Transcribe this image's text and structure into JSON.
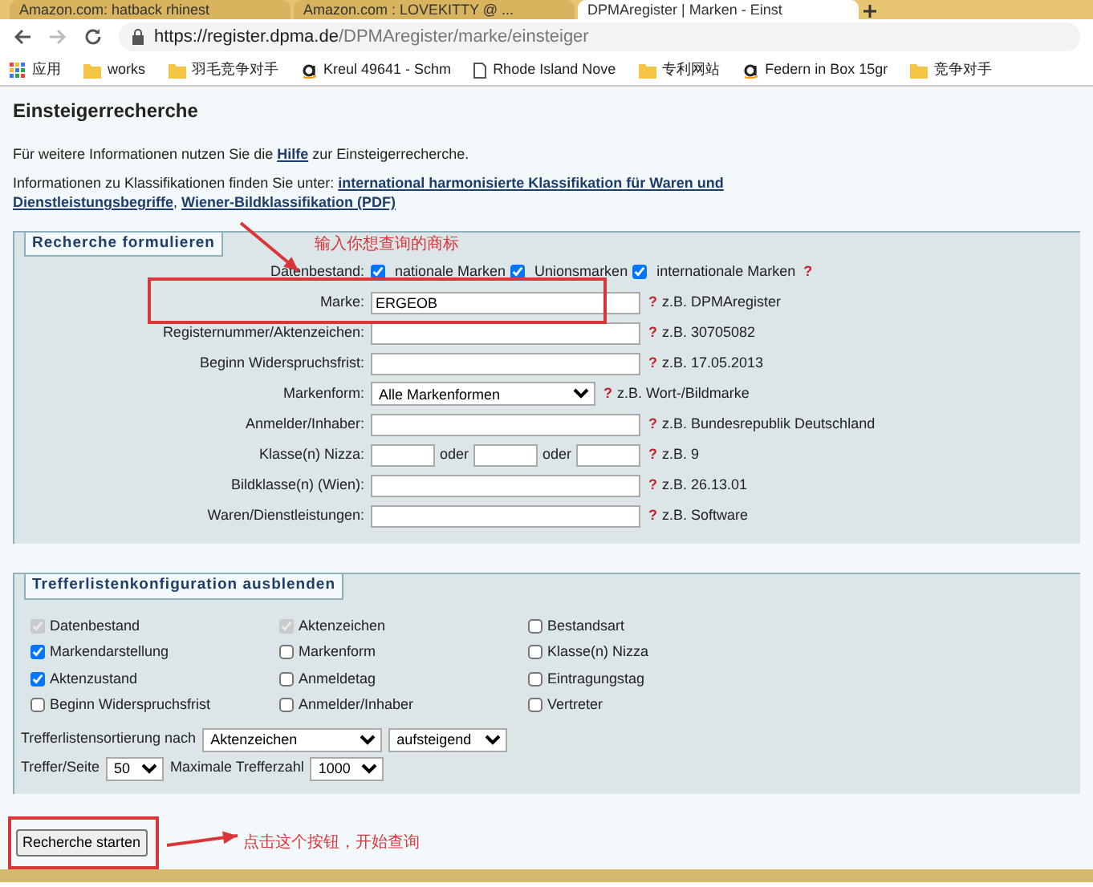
{
  "browser": {
    "tabs": [
      {
        "title": "Amazon.com: hatback rhinest",
        "selected": false
      },
      {
        "title": "Amazon.com : LOVEKITTY @ ...",
        "selected": false
      },
      {
        "title": "DPMAregister | Marken - Einst",
        "selected": true
      }
    ],
    "url_host": "https://register.dpma.de",
    "url_path": "/DPMAregister/marke/einsteiger",
    "bookmarks": [
      {
        "label": "应用",
        "kind": "apps"
      },
      {
        "label": "works",
        "kind": "folder"
      },
      {
        "label": "羽毛竞争对手",
        "kind": "folder"
      },
      {
        "label": "Kreul 49641 - Schm",
        "kind": "amazon"
      },
      {
        "label": "Rhode Island Nove",
        "kind": "page"
      },
      {
        "label": "专利网站",
        "kind": "folder"
      },
      {
        "label": "Federn in Box 15gr",
        "kind": "amazon"
      },
      {
        "label": "竞争对手",
        "kind": "folder"
      }
    ]
  },
  "page": {
    "title": "Einsteigerrecherche",
    "paragraphs": [
      [
        {
          "text": "Für weitere Informationen nutzen Sie die ",
          "kind": "text"
        },
        {
          "text": "Hilfe",
          "kind": "link"
        },
        {
          "text": " zur Einsteigerrecherche.",
          "kind": "text"
        }
      ],
      [
        {
          "text": "Informationen zu Klassifikationen finden Sie unter: ",
          "kind": "text"
        },
        {
          "text": "international harmonisierte Klassifikation für Waren und",
          "kind": "link"
        },
        {
          "text": "Dienstleistungsbegriffe",
          "kind": "link"
        },
        {
          "text": ", ",
          "kind": "text"
        },
        {
          "text": "Wiener-Bildklassifikation (PDF)",
          "kind": "link"
        }
      ]
    ],
    "search_form": {
      "legend": "Recherche formulieren",
      "rows": [
        {
          "label": "Datenbestand:",
          "kind": "checkboxes",
          "options": [
            {
              "label": "nationale Marken",
              "checked": true
            },
            {
              "label": "Unionsmarken",
              "checked": true
            },
            {
              "label": "internationale Marken",
              "checked": true
            }
          ],
          "help": "?"
        },
        {
          "label": "Marke:",
          "kind": "text",
          "value": "ERGEOB",
          "help": "?",
          "hint": "z.B. DPMAregister"
        },
        {
          "label": "Registernummer/Aktenzeichen:",
          "kind": "text",
          "help": "?",
          "hint": "z.B. 30705082"
        },
        {
          "label": "Beginn Widerspruchsfrist:",
          "kind": "text",
          "help": "?",
          "hint": "z.B. 17.05.2013"
        },
        {
          "label": "Markenform:",
          "kind": "select",
          "value": "Alle Markenformen",
          "help": "?",
          "hint": "z.B. Wort-/Bildmarke"
        },
        {
          "label": "Anmelder/Inhaber:",
          "kind": "text",
          "help": "?",
          "hint": "z.B. Bundesrepublik Deutschland"
        },
        {
          "label": "Klasse(n) Nizza:",
          "kind": "triple",
          "separators": [
            "oder",
            "oder"
          ],
          "help": "?",
          "hint": "z.B. 9"
        },
        {
          "label": "Bildklasse(n) (Wien):",
          "kind": "text",
          "help": "?",
          "hint": "z.B. 26.13.01"
        },
        {
          "label": "Waren/Dienstleistungen:",
          "kind": "text",
          "help": "?",
          "hint": "z.B. Software"
        }
      ]
    },
    "result_config": {
      "legend": "Trefferlistenkonfiguration ausblenden",
      "columns": [
        {
          "label": "Datenbestand",
          "checked": true,
          "disabled": true
        },
        {
          "label": "Aktenzeichen",
          "checked": true,
          "disabled": true
        },
        {
          "label": "Bestandsart",
          "checked": false,
          "disabled": false
        },
        {
          "label": "Markendarstellung",
          "checked": true,
          "disabled": false
        },
        {
          "label": "Markenform",
          "checked": false,
          "disabled": false
        },
        {
          "label": "Klasse(n) Nizza",
          "checked": false,
          "disabled": false
        },
        {
          "label": "Aktenzustand",
          "checked": true,
          "disabled": false
        },
        {
          "label": "Anmeldetag",
          "checked": false,
          "disabled": false
        },
        {
          "label": "Eintragungstag",
          "checked": false,
          "disabled": false
        },
        {
          "label": "Beginn Widerspruchsfrist",
          "checked": false,
          "disabled": false
        },
        {
          "label": "Anmelder/Inhaber",
          "checked": false,
          "disabled": false
        },
        {
          "label": "Vertreter",
          "checked": false,
          "disabled": false
        }
      ],
      "sort_label": "Trefferlistensortierung nach",
      "sort_field": "Aktenzeichen",
      "sort_order": "aufsteigend",
      "per_page_label": "Treffer/Seite",
      "per_page": "50",
      "max_label": "Maximale Trefferzahl",
      "max": "1000"
    },
    "submit": "Recherche starten"
  },
  "annotations": [
    {
      "text": "输入你想查询的商标"
    },
    {
      "text": "点击这个按钮，开始查询"
    }
  ]
}
